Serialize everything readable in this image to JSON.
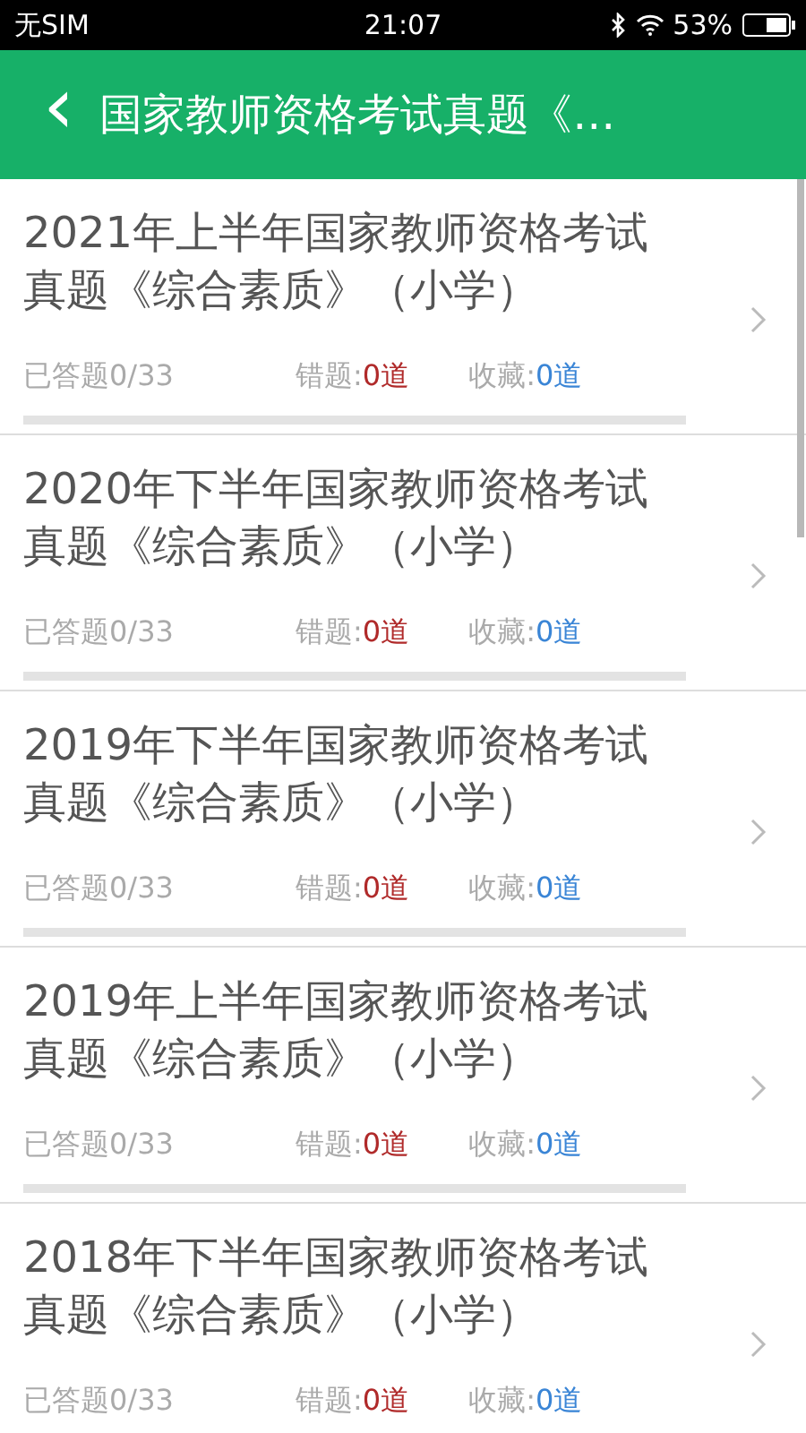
{
  "status_bar": {
    "carrier": "无SIM",
    "time": "21:07",
    "battery": "53%"
  },
  "header": {
    "back": "‹",
    "title": "国家教师资格考试真题《…"
  },
  "papers": [
    {
      "title": "2021年上半年国家教师资格考试真题《综合素质》（小学）",
      "answered": "已答题0/33",
      "wrong_label": "错题:",
      "wrong": "0道",
      "fav_label": "收藏:",
      "fav": "0道",
      "level": 0
    },
    {
      "title": "2020年下半年国家教师资格考试真题《综合素质》（小学）",
      "answered": "已答题0/33",
      "wrong_label": "错题:",
      "wrong": "0道",
      "fav_label": "收藏:",
      "fav": "0道",
      "level": 0
    },
    {
      "title": "2019年下半年国家教师资格考试真题《综合素质》（小学）",
      "answered": "已答题0/33",
      "wrong_label": "错题:",
      "wrong": "0道",
      "fav_label": "收藏:",
      "fav": "0道",
      "level": 0
    },
    {
      "title": "2019年上半年国家教师资格考试真题《综合素质》（小学）",
      "answered": "已答题0/33",
      "wrong_label": "错题:",
      "wrong": "0道",
      "fav_label": "收藏:",
      "fav": "0道",
      "level": 0
    },
    {
      "title": "2018年下半年国家教师资格考试真题《综合素质》（小学）",
      "answered": "已答题0/33",
      "wrong_label": "错题:",
      "wrong": "0道",
      "fav_label": "收藏:",
      "fav": "0道"
    }
  ]
}
